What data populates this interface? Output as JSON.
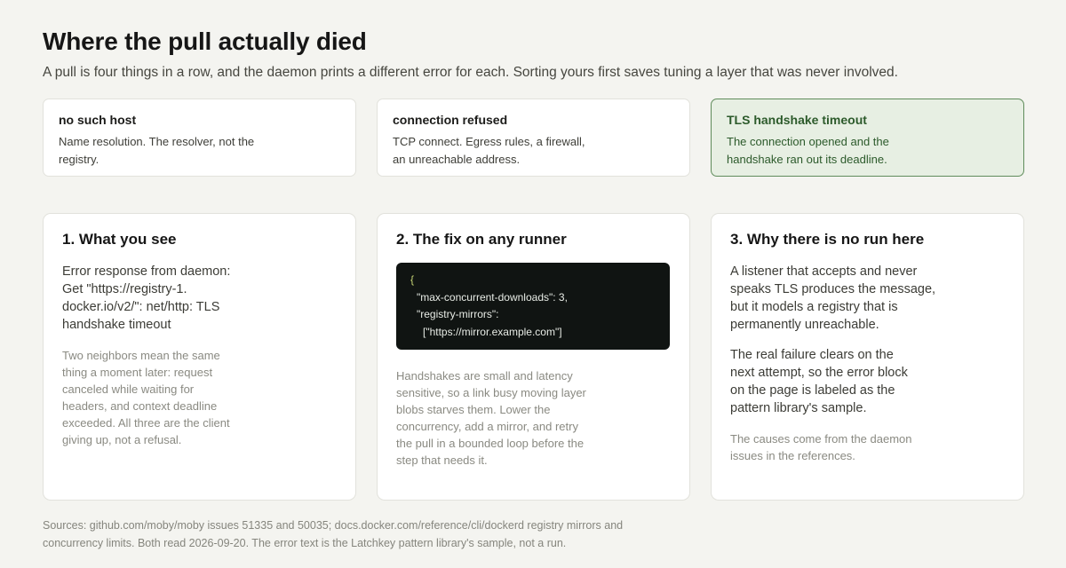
{
  "header": {
    "title": "Where the pull actually died",
    "subtitle": "A pull is four things in a row, and the daemon prints a different error for each. Sorting yours first saves tuning a layer that was never involved."
  },
  "error_cards": [
    {
      "name": "no such host",
      "desc": "Name resolution. The resolver, not the registry.",
      "active": false
    },
    {
      "name": "connection refused",
      "desc": "TCP connect. Egress rules, a firewall, an unreachable address.",
      "active": false
    },
    {
      "name": "TLS handshake timeout",
      "desc": "The connection opened and the handshake ran out its deadline.",
      "active": true
    }
  ],
  "panels": {
    "see": {
      "title": "1. What you see",
      "error_text": "Error response from daemon: Get \"https://registry-1. docker.io/v2/\": net/http: TLS handshake timeout",
      "note": "Two neighbors mean the same thing a moment later: request canceled while waiting for headers, and context deadline exceeded. All three are the client giving up, not a refusal."
    },
    "fix": {
      "title": "2. The fix on any runner",
      "code": {
        "open": "{",
        "line1": "\"max-concurrent-downloads\": 3,",
        "line2": "\"registry-mirrors\":",
        "line3": "[\"https://mirror.example.com\"]"
      },
      "note": "Handshakes are small and latency sensitive, so a link busy moving layer blobs starves them. Lower the concurrency, add a mirror, and retry the pull in a bounded loop before the step that needs it."
    },
    "why": {
      "title": "3. Why there is no run here",
      "para1": "A listener that accepts and never speaks TLS produces the message, but it models a registry that is permanently unreachable.",
      "para2": "The real failure clears on the next attempt, so the error block on the page is labeled as the pattern library's sample.",
      "note": "The causes come from the daemon issues in the references."
    }
  },
  "footer": {
    "sources": "Sources: github.com/moby/moby issues 51335 and 50035; docs.docker.com/reference/cli/dockerd registry mirrors and concurrency limits. Both read 2026-09-20. The error text is the Latchkey pattern library's sample, not a run."
  },
  "colors": {
    "background": "#f4f4f0",
    "active_card_bg": "#e7efe3",
    "active_card_border": "#5f8c5b",
    "active_text": "#2c5a2b",
    "code_bg": "#101412"
  }
}
